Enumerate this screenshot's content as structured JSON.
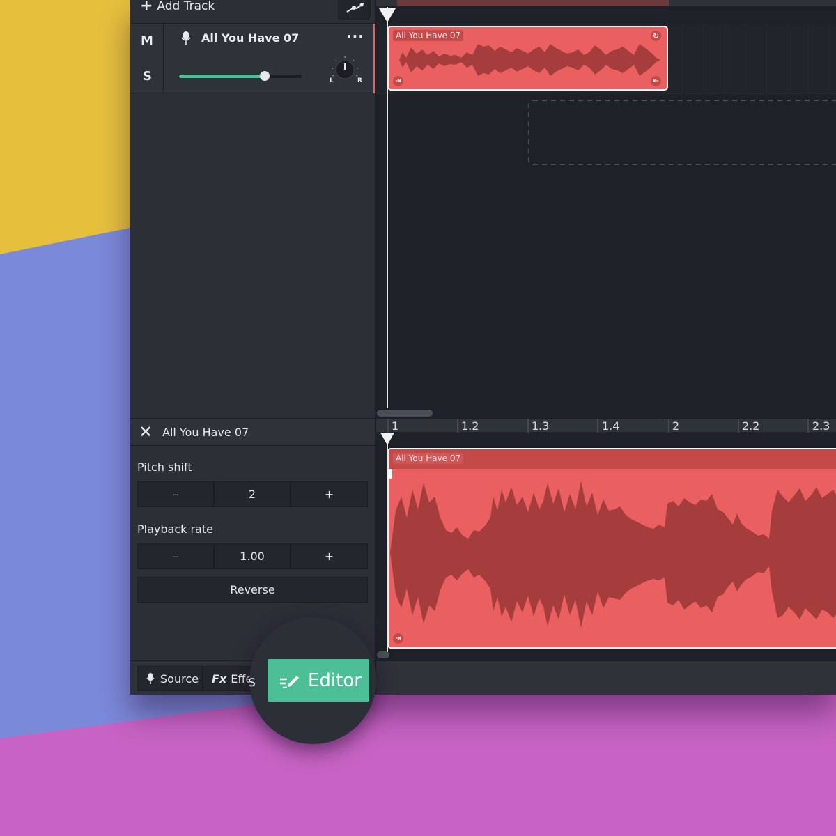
{
  "toolbar": {
    "add_track_label": "Add Track"
  },
  "track": {
    "name": "All You Have 07",
    "mute_label": "M",
    "solo_label": "S",
    "volume": 0.7,
    "pan_left": "L",
    "pan_right": "R",
    "menu_icon": "more-dots-icon"
  },
  "clip": {
    "label": "All You Have 07"
  },
  "editor_panel": {
    "title": "All You Have 07",
    "pitch_shift_label": "Pitch shift",
    "pitch_value": "2",
    "playback_rate_label": "Playback rate",
    "playback_value": "1.00",
    "minus": "–",
    "plus": "+",
    "reverse_label": "Reverse"
  },
  "editor_ruler": [
    "1",
    "1.2",
    "1.3",
    "1.4",
    "2",
    "2.2",
    "2.3"
  ],
  "editor_clip": {
    "label": "All You Have 07"
  },
  "bottom_tabs": {
    "source_label": "Source",
    "effects_prefix": "Fx",
    "effects_label": "Effec",
    "effects_overflow": "s",
    "editor_label": "Editor"
  },
  "colors": {
    "accent": "#4dbf97",
    "clip": "#ea5f5f",
    "clip_wave": "#a53d3d",
    "panel": "#2b2f36",
    "timeline": "#1e2127"
  }
}
